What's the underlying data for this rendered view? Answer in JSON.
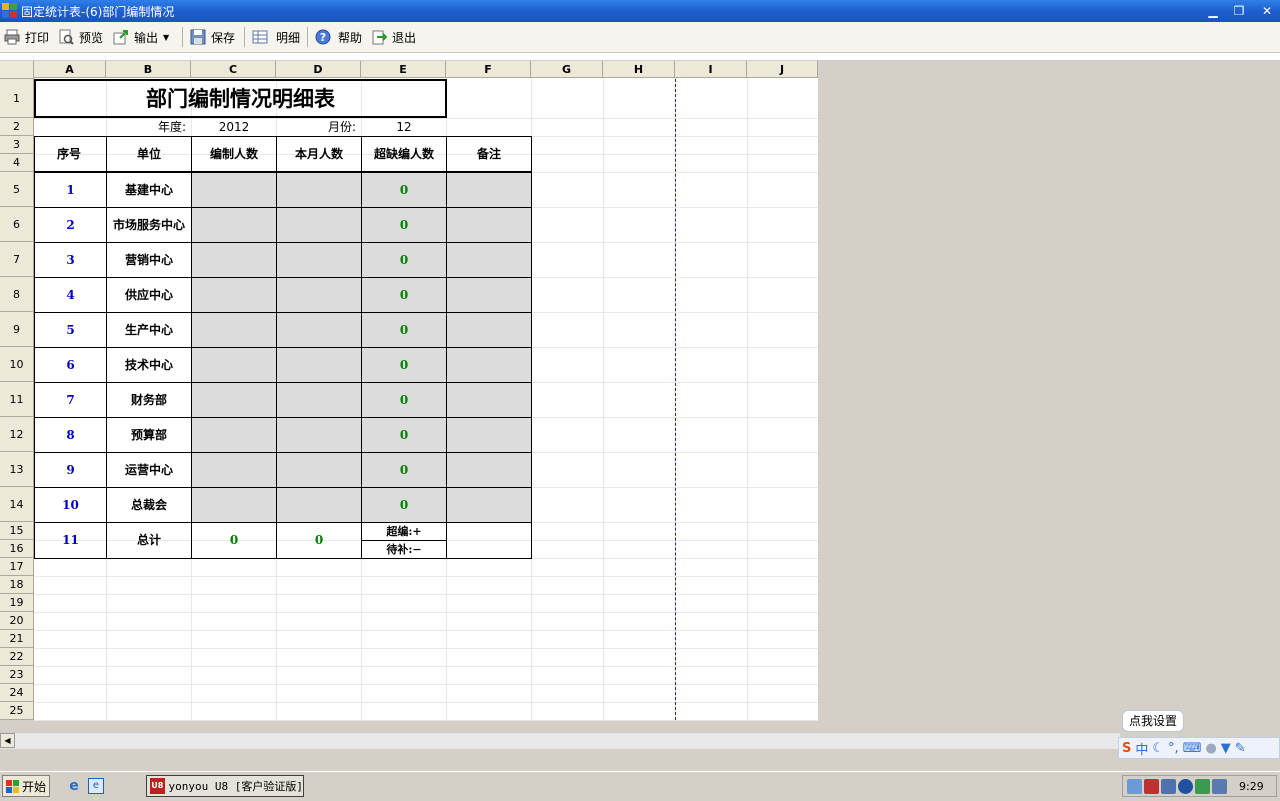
{
  "window": {
    "title": "固定统计表-(6)部门编制情况"
  },
  "toolbar": {
    "print": "打印",
    "preview": "预览",
    "export": "输出",
    "save": "保存",
    "detail": "明细",
    "help": "帮助",
    "exit": "退出"
  },
  "columns": [
    "A",
    "B",
    "C",
    "D",
    "E",
    "F",
    "G",
    "H",
    "I",
    "J"
  ],
  "rows": [
    "1",
    "2",
    "3",
    "4",
    "5",
    "6",
    "7",
    "8",
    "9",
    "10",
    "11",
    "12",
    "13",
    "14",
    "15",
    "16",
    "17",
    "18",
    "19",
    "20",
    "21",
    "22",
    "23",
    "24",
    "25"
  ],
  "sheet": {
    "title": "部门编制情况明细表",
    "year_label": "年度:",
    "year_value": "2012",
    "month_label": "月份:",
    "month_value": "12",
    "headers": {
      "seq": "序号",
      "unit": "单位",
      "staffing": "编制人数",
      "current": "本月人数",
      "over_short": "超缺编人数",
      "remark": "备注"
    },
    "data": [
      {
        "seq": "1",
        "unit": "基建中心",
        "over_short": "0"
      },
      {
        "seq": "2",
        "unit": "市场服务中心",
        "over_short": "0"
      },
      {
        "seq": "3",
        "unit": "营销中心",
        "over_short": "0"
      },
      {
        "seq": "4",
        "unit": "供应中心",
        "over_short": "0"
      },
      {
        "seq": "5",
        "unit": "生产中心",
        "over_short": "0"
      },
      {
        "seq": "6",
        "unit": "技术中心",
        "over_short": "0"
      },
      {
        "seq": "7",
        "unit": "财务部",
        "over_short": "0"
      },
      {
        "seq": "8",
        "unit": "预算部",
        "over_short": "0"
      },
      {
        "seq": "9",
        "unit": "运营中心",
        "over_short": "0"
      },
      {
        "seq": "10",
        "unit": "总裁会",
        "over_short": "0"
      }
    ],
    "total": {
      "seq": "11",
      "label": "总计",
      "staffing": "0",
      "current": "0",
      "over": "超编:+",
      "short": "待补:−"
    }
  },
  "ime": {
    "tip": "点我设置",
    "mode": "中"
  },
  "taskbar": {
    "start": "开始",
    "app": "yonyou U8 [客户验证版]",
    "clock": "9:29"
  }
}
